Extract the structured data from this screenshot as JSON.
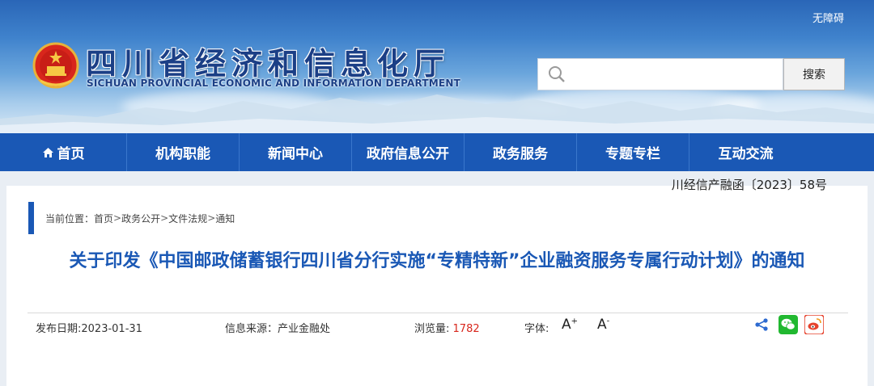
{
  "header": {
    "accessibility_link": "无障碍",
    "title_cn": "四川省经济和信息化厅",
    "title_en": "SICHUAN PROVINCIAL ECONOMIC AND INFORMATION DEPARTMENT",
    "search": {
      "value": "",
      "placeholder": "",
      "button_label": "搜索"
    },
    "brand_color": "#1b3f86"
  },
  "nav": {
    "items": [
      {
        "label": "首页",
        "icon": "home-icon"
      },
      {
        "label": "机构职能"
      },
      {
        "label": "新闻中心"
      },
      {
        "label": "政府信息公开"
      },
      {
        "label": "政务服务"
      },
      {
        "label": "专题专栏"
      },
      {
        "label": "互动交流"
      }
    ],
    "background": "#1a58b5"
  },
  "breadcrumb": {
    "prefix": "当前位置：",
    "items": [
      "首页",
      "政务公开",
      "文件法规",
      "通知"
    ],
    "separator": ">"
  },
  "article": {
    "title": "关于印发《中国邮政储蓄银行四川省分行实施“专精特新”企业融资服务专属行动计划》的通知",
    "publish_date": "发布日期:2023-01-31",
    "source": "信息来源：产业金融处",
    "views_label": "浏览量:",
    "views_count": "1782",
    "font_label": "字体:",
    "font_increase": "A",
    "font_increase_sup": "+",
    "font_decrease": "A",
    "font_decrease_sup": "-",
    "share_icons": [
      "share-icon",
      "wechat-icon",
      "weibo-icon"
    ],
    "doc_number": "川经信产融函〔2023〕58号",
    "title_color": "#1a58b5",
    "views_color": "#d8261c"
  }
}
